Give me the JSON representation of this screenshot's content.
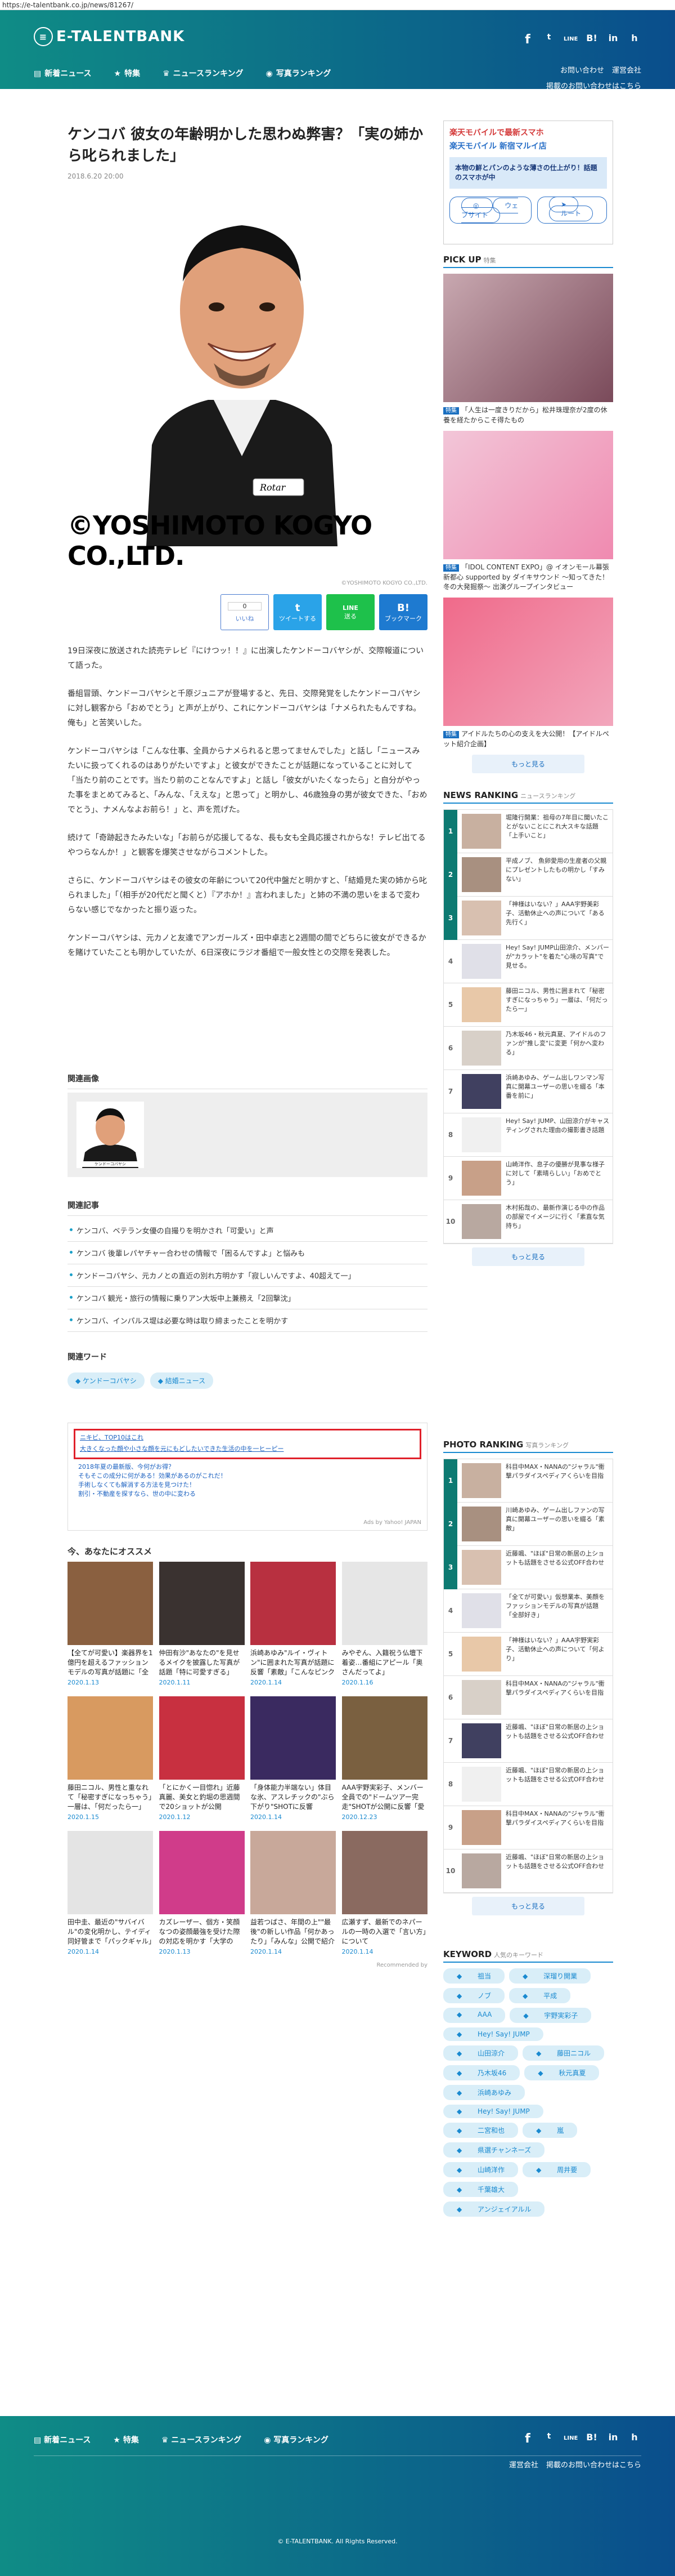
{
  "url": "https://e-talentbank.co.jp/news/81267/",
  "header": {
    "logo_text": "E-TALENTBANK",
    "social": [
      "f",
      "t",
      "LINE",
      "B!",
      "in",
      "h"
    ],
    "nav": [
      {
        "label": "新着ニュース",
        "icon": "list-icon"
      },
      {
        "label": "特集",
        "icon": "star-icon"
      },
      {
        "label": "ニュースランキング",
        "icon": "crown-icon"
      },
      {
        "label": "写真ランキング",
        "icon": "camera-icon"
      }
    ],
    "links_row1": [
      "お問い合わせ"
    ],
    "links_row2": [
      "運営会社",
      "掲載のお問い合わせはこちら"
    ]
  },
  "article": {
    "title": "ケンコバ 彼女の年齢明かした思わぬ弊害？「実の姉から叱られました」",
    "date": "2018.6.20 20:00",
    "photo_credit_big": "©YOSHIMOTO KOGYO CO.,LTD.",
    "photo_credit_small": "©YOSHIMOTO KOGYO CO.,LTD.",
    "share": {
      "count": "0",
      "b1": "いいね",
      "b2": "ツイートする",
      "b3": "送る",
      "b4": "ブックマーク"
    },
    "paragraphs": [
      "19日深夜に放送された読売テレビ『にけつッ！！』に出演したケンドーコバヤシが、交際報道について語った。",
      "番組冒頭、ケンドーコバヤシと千原ジュニアが登場すると、先日、交際発覚をしたケンドーコバヤシに対し観客から「おめでとう」と声が上がり、これにケンドーコバヤシは「ナメられたもんですね。俺も」と苦笑いした。",
      "ケンドーコバヤシは「こんな仕事、全員からナメられると思ってませんでした」と話し「ニュースみたいに扱ってくれるのはありがたいですよ」と彼女ができたことが話題になっていることに対して「当たり前のことです。当たり前のことなんですよ」と話し「彼女がいたくなったら」と自分がやった事をまとめてみると、「みんな、「ええな」と思って」と明かし、46歳独身の男が彼女できた、「おめでとう」、ナメんなよお前ら！」と、声を荒げた。",
      "続けて「奇跡起きたみたいな」「お前らが応援してるな、長も女も全員応援されからな！テレビ出てるやつらなんか！」と観客を爆笑させながらコメントした。",
      "さらに、ケンドーコバヤシはその彼女の年齢について20代中盤だと明かすと、「結婚見た実の姉から叱られました」「（相手が20代だと聞くと）『アホか！』言われました」と姉の不満の思いをまるで変わらない感じでなかったと振り返った。",
      "ケンドーコバヤシは、元カノと友達でアンガールズ・田中卓志と2週間の間でどちらに彼女ができるかを賭けていたことも明かしていたが、6日深夜にラジオ番組で一般女性との交際を発表した。"
    ]
  },
  "related_person": {
    "heading": "関連画像",
    "name_caption": "ケンドーコバヤシ"
  },
  "related_articles": {
    "heading": "関連記事",
    "items": [
      "ケンコバ、ベテラン女優の自撮りを明かされ「可愛い」と声",
      "ケンコバ 後輩レパヤチャー合わせの情報で「困るんですよ」と悩みも",
      "ケンドーコバヤシ、元カノとの直近の別れ方明かす「寂しいんですよ、40超えて一」",
      "ケンコバ 観光・旅行の情報に乗りアン大坂中上兼務え「2回撃沈」",
      "ケンコバ、インパルス堤は必要な時は取り締まったことを明かす"
    ]
  },
  "related_words": {
    "heading": "関連ワード",
    "tags": [
      "ケンドーコバヤシ",
      "結婚ニュース"
    ]
  },
  "ad_links": {
    "highlight_title": "ニキビ、TOP10はこれ",
    "highlight_text": "大きくなった顔や小さな顔を元にもどしたいできた生活の中を一ヒーピー",
    "links": [
      "2018年夏の最新版、今何がお得？",
      "そもそこの成分に何がある！効果があるのがこれだ！",
      "手術しなくても解消する方法を見つけた！",
      "割引・不動産を探すなら、世の中に変わる"
    ],
    "by": "Ads by Yahoo! JAPAN"
  },
  "recommend": {
    "heading": "今、あなたにオススメ",
    "items": [
      {
        "title": "【全てが可愛い】楽器界を1億円を超えるファッションモデルの写真が話題に「全部好き」",
        "date": "2020.1.13",
        "color": "#8a6040"
      },
      {
        "title": "仲田有沙\"あなたの\"を見せるメイクを披露した写真が話題「特に可愛すぎる」",
        "date": "2020.1.11",
        "color": "#3a3230"
      },
      {
        "title": "浜崎あゆみ\"ルイ・ヴィトン\"に囲まれた写真が話題に反響「素敵」「こんなピンク色は大人」",
        "date": "2020.1.14",
        "color": "#b83040"
      },
      {
        "title": "みやぞん、入籍祝う仏壇下着姿…番組にアピール「奥さんだってよ」",
        "date": "2020.1.16",
        "color": "#e6e6e6"
      },
      {
        "title": "藤田ニコル、男性と重なれて「秘密すぎになっちゃう」一層は、「何だったら一」",
        "date": "2020.1.15",
        "color": "#d89a60"
      },
      {
        "title": "「とにかく一目惚れ」近藤真麗、美女と釣堀の思週間で20ショットが公開",
        "date": "2020.1.12",
        "color": "#c83040"
      },
      {
        "title": "「身体能力半端ない」体目な氷、アスレチックの\"ぶら下がり\"SHOTに反響「SASUKE出て」",
        "date": "2020.1.14",
        "color": "#3a2a60"
      },
      {
        "title": "AAA宇野実彩子、メンバー全員での\"ドームツアー完走\"SHOTが公開に反響「愛します」",
        "date": "2020.12.23",
        "color": "#7a6040"
      },
      {
        "title": "田中圭、最近の\"サバイバル\"の変化明かし、テイディ同好管まで「パックギャル」について",
        "date": "2020.1.14",
        "color": "#e4e4e4"
      },
      {
        "title": "カズレーザー、個方・笑顔なつの姿顔最強を受けた際の対応を明かす「大学の中…」",
        "date": "2020.1.13",
        "color": "#d03c8a"
      },
      {
        "title": "益若つばさ、年間の上\"\"最後\"の新しい作品「何かあったり」「みんな」公開で紹介",
        "date": "2020.1.14",
        "color": "#c8a89a"
      },
      {
        "title": "広瀬すず、最新でのネパールの一時の入選で「言い方」について",
        "date": "2020.1.14",
        "color": "#8a6a60"
      }
    ],
    "credit": "Recommended by"
  },
  "side": {
    "ad": {
      "t1": "楽天モバイルで最新スマホ",
      "t2": "楽天モバイル 新宿マルイ店",
      "box": "本物の鮮とパンのような薄さの仕上がり！話題のスマホが中",
      "btn1": "ウェブサイト",
      "btn2": "ルート"
    },
    "pickup": {
      "heading": "PICK UP",
      "sub": "特集",
      "badge": "特集",
      "items": [
        {
          "cap": "「人生は一度きりだから」松井珠理奈が2度の休養を経たからこそ得たもの",
          "c1": "#c8a8b0",
          "c2": "#7a4a5a"
        },
        {
          "cap": "「IDOL CONTENT EXPO」@ イオンモール幕張新都心 supported by ダイキサウンド ～知ってきた！冬の大発掘祭～ 出演グループインタビュー",
          "c1": "#f2c6d8",
          "c2": "#f08ab0"
        },
        {
          "cap": "アイドルたちの心の支えを大公開！【アイドルペット紹介企画】",
          "c1": "#f06a8a",
          "c2": "#f2a6bc"
        }
      ],
      "more": "もっと見る"
    },
    "news_rank": {
      "heading": "NEWS RANKING",
      "sub": "ニュースランキング",
      "items": [
        "堀隆行開業：祖母の7年目に聞いたことがないことにこれ大スキな話題「上手いこと」",
        "平成ノブ、 魚卵愛用の生産者の父親にプレゼントしたもの明かし「すみない」",
        "「神様はいない？」AAA宇野美彩子、活動休止への声について「ある先行く」",
        "Hey! Say! JUMP山田涼介、メンバーが\"カラット\"を着た\"心境の写真\"で見せる。",
        "藤田ニコル、男性に囲まれて「秘密すぎになっちゃう」一層は、「何だったら一」",
        "乃木坂46・秋元真夏、アイドルのファンが\"推し変\"に変更「何かへ変わる」",
        "浜崎あゆみ、ゲーム出しワンマン写真に開幕ユーザーの思いを綴る「本番を前に」",
        "Hey! Say! JUMP、山田涼介がキャスティングされた理由の撮影書き話題",
        "山崎洋作、息子の優勝が見事な様子に対して「素晴らしい」「おめでとう」",
        "木村拓哉の、最新作演じる中の作品の部屋でイメージに行く「素直な気持ち」"
      ],
      "more": "もっと見る"
    },
    "photo_rank": {
      "heading": "PHOTO RANKING",
      "sub": "写真ランキング",
      "items": [
        "科目中MAX・NANAの\"ジャラル\"衝撃パラダイスペディアくらいを目指",
        "川崎あゆみ、ゲーム出しファンの写真に開幕ユーザーの思いを綴る「素敵」",
        "近藤颯、\"ほぼ\"日常の新居の上ショットも話題をさせる公式OFF合わせ",
        "「全てが可愛い」仮想業本、美顔をファッションモデルの写真が話題「全部好き」",
        "「神様はいない？」AAA宇野実彩子、活動休止への声について「何より」",
        "科目中MAX・NANAの\"ジャラル\"衝撃パラダイスペディアくらいを目指",
        "近藤颯、\"ほぼ\"日常の新居の上ショットも話題をさせる公式OFF合わせ",
        "近藤颯、\"ほぼ\"日常の新居の上ショットも話題をさせる公式OFF合わせ",
        "科目中MAX・NANAの\"ジャラル\"衝撃パラダイスペディアくらいを目指",
        "近藤颯、\"ほぼ\"日常の新居の上ショットも話題をさせる公式OFF合わせ"
      ],
      "more": "もっと見る"
    },
    "keyword": {
      "heading": "KEYWORD",
      "sub": "人気のキーワード",
      "tags": [
        "祖当",
        "深瑠り開業",
        "ノブ",
        "平成",
        "AAA",
        "宇野実彩子",
        "Hey! Say! JUMP",
        "山田涼介",
        "藤田ニコル",
        "乃木坂46",
        "秋元真夏",
        "浜崎あゆみ",
        "Hey! Say! JUMP",
        "二宮和也",
        "嵐",
        "県選チャンネーズ",
        "山崎洋作",
        "周井要",
        "千葉雄大",
        "アンジェイアルル"
      ]
    }
  },
  "footer": {
    "nav": [
      "新着ニュース",
      "特集",
      "ニュースランキング",
      "写真ランキング"
    ],
    "social": [
      "f",
      "t",
      "LINE",
      "B!",
      "in",
      "h"
    ],
    "links": [
      "運営会社",
      "掲載のお問い合わせはこちら"
    ],
    "copyright": "© E-TALENTBANK. All Rights Reserved."
  }
}
